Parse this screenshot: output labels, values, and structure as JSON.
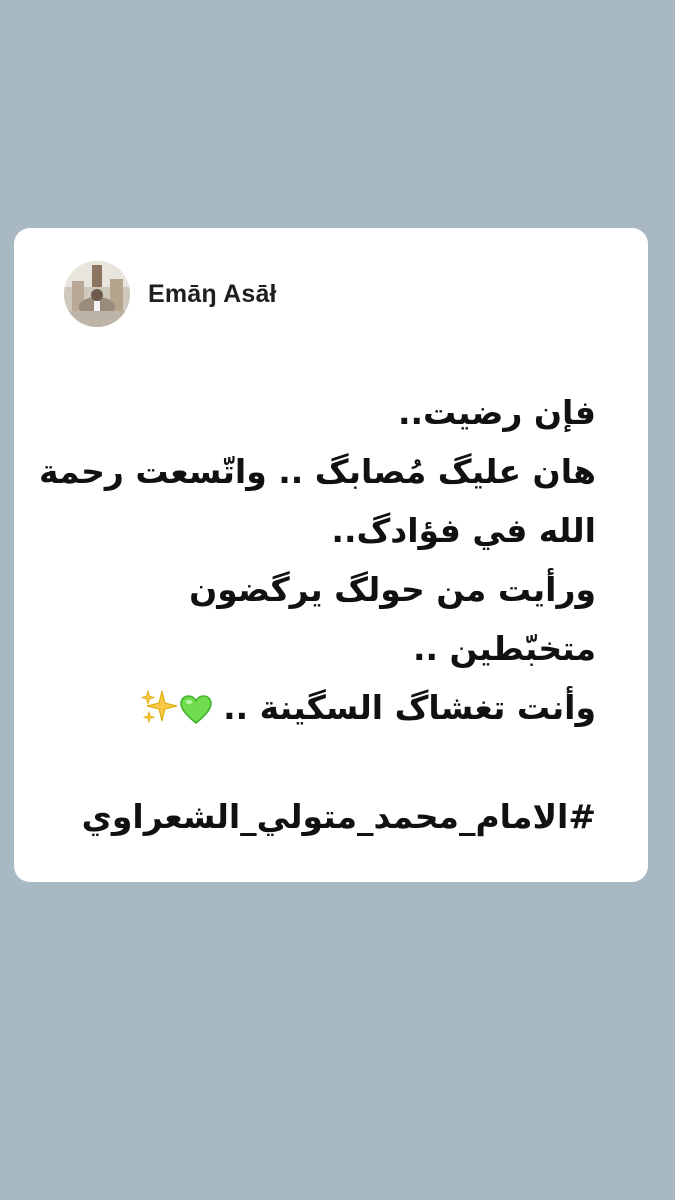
{
  "post": {
    "author_name": "Emāŋ Asāł",
    "lines": [
      "فإن رضيت..",
      "هان عليگ مُصابگ .. واتّسعت رحمة",
      "الله في فؤادگ..",
      "ورأيت من حولگ يرگضون",
      "متخبّطين ..",
      "وأنت تغشاگ السگينة .."
    ],
    "emojis": [
      "green-heart",
      "sparkles"
    ],
    "hashtag": "#الامام_محمد_متولي_الشعراوي"
  },
  "colors": {
    "background": "#a8b9c3",
    "card": "#ffffff",
    "text": "#111111",
    "heart": "#6fdc4d",
    "sparkles": "#f7c948"
  }
}
